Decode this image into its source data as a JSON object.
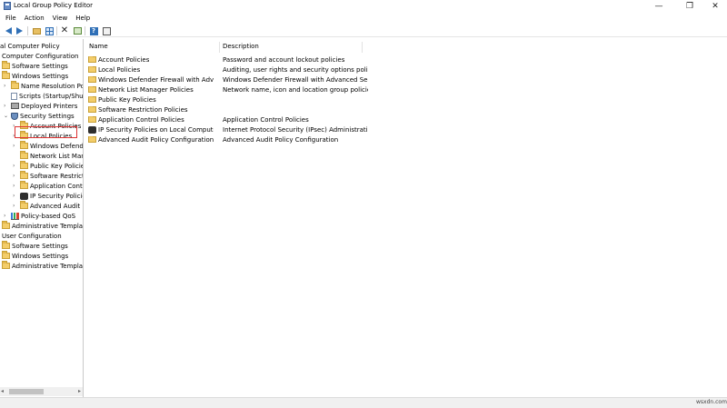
{
  "window": {
    "title": "Local Group Policy Editor",
    "minimize": "—",
    "maximize": "❐",
    "close": "✕"
  },
  "menu": [
    "File",
    "Action",
    "View",
    "Help"
  ],
  "toolbar": {
    "icons": [
      "back-arrow-icon",
      "forward-arrow-icon",
      "up-folder-icon",
      "show-hide-tree-icon",
      "delete-icon",
      "export-list-icon",
      "help-icon",
      "properties-icon"
    ]
  },
  "tree": {
    "items": [
      {
        "label": "al Computer Policy"
      },
      {
        "label": "Computer Configuration"
      },
      {
        "label": "Software Settings"
      },
      {
        "label": "Windows Settings"
      },
      {
        "label": "Name Resolution Polic"
      },
      {
        "label": "Scripts (Startup/Shutd"
      },
      {
        "label": "Deployed Printers"
      },
      {
        "label": "Security Settings"
      },
      {
        "label": "Account Policies"
      },
      {
        "label": "Local Policies"
      },
      {
        "label": "Windows Defende"
      },
      {
        "label": "Network List Mana"
      },
      {
        "label": "Public Key Policies"
      },
      {
        "label": "Software Restrictic"
      },
      {
        "label": "Application Contro"
      },
      {
        "label": "IP Security Policies"
      },
      {
        "label": "Advanced Audit P"
      },
      {
        "label": "Policy-based QoS"
      },
      {
        "label": "Administrative Templates"
      },
      {
        "label": "User Configuration"
      },
      {
        "label": "Software Settings"
      },
      {
        "label": "Windows Settings"
      },
      {
        "label": "Administrative Templates"
      }
    ]
  },
  "details": {
    "columns": {
      "name": "Name",
      "description": "Description"
    },
    "rows": [
      {
        "name": "Account Policies",
        "description": "Password and account lockout policies"
      },
      {
        "name": "Local Policies",
        "description": "Auditing, user rights and security options polici..."
      },
      {
        "name": "Windows Defender Firewall with Advanc...",
        "description": "Windows Defender Firewall with Advanced Sec..."
      },
      {
        "name": "Network List Manager Policies",
        "description": "Network name, icon and location group policies."
      },
      {
        "name": "Public Key Policies",
        "description": ""
      },
      {
        "name": "Software Restriction Policies",
        "description": ""
      },
      {
        "name": "Application Control Policies",
        "description": "Application Control Policies"
      },
      {
        "name": "IP Security Policies on Local Computer",
        "description": "Internet Protocol Security (IPsec) Administratio..."
      },
      {
        "name": "Advanced Audit Policy Configuration",
        "description": "Advanced Audit Policy Configuration"
      }
    ]
  },
  "watermark": "wsxdn.com"
}
